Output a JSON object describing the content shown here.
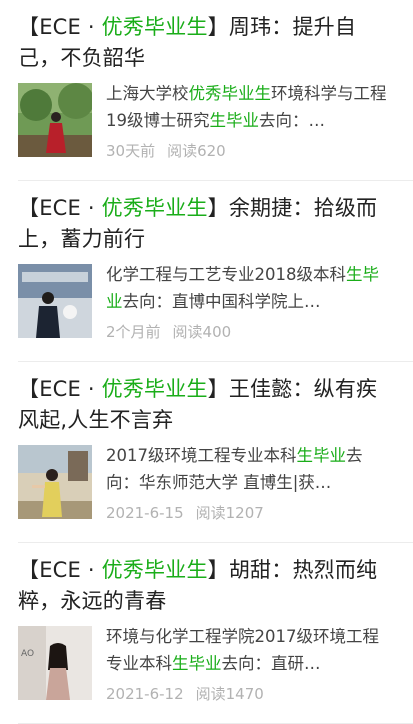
{
  "articles": [
    {
      "title_prefix": "【ECE · ",
      "title_highlight": "优秀毕业生",
      "title_rest": "】周玮：提升自己，不负韶华",
      "summary_a": "上海大学校",
      "summary_hl1": "优秀毕业生",
      "summary_b": "环境科学与工程19级博士研究",
      "summary_hl2": "生毕业",
      "summary_c": "去向：…",
      "date": "30天前",
      "reads": "阅读620"
    },
    {
      "title_prefix": "【ECE · ",
      "title_highlight": "优秀毕业生",
      "title_rest": "】余期捷：拾级而上，蓄力前行",
      "summary_a": "化学工程与工艺专业2018级本科",
      "summary_hl1": "生毕业",
      "summary_b": "去向：直博中国科学院上…",
      "summary_hl2": "",
      "summary_c": "",
      "date": "2个月前",
      "reads": "阅读400"
    },
    {
      "title_prefix": "【ECE · ",
      "title_highlight": "优秀毕业生",
      "title_rest": "】王佳懿：纵有疾风起,人生不言弃",
      "summary_a": "2017级环境工程专业本科",
      "summary_hl1": "生毕业",
      "summary_b": "去向：华东师范大学 直博生|获…",
      "summary_hl2": "",
      "summary_c": "",
      "date": "2021-6-15",
      "reads": "阅读1207"
    },
    {
      "title_prefix": "【ECE · ",
      "title_highlight": "优秀毕业生",
      "title_rest": "】胡甜：热烈而纯粹，永远的青春",
      "summary_a": "环境与化学工程学院2017级环境工程专业本科",
      "summary_hl1": "生毕业",
      "summary_b": "去向：直研…",
      "summary_hl2": "",
      "summary_c": "",
      "date": "2021-6-12",
      "reads": "阅读1470"
    }
  ],
  "colors": {
    "highlight": "#1aad19",
    "title": "#222222",
    "meta": "#b2b2b2"
  }
}
